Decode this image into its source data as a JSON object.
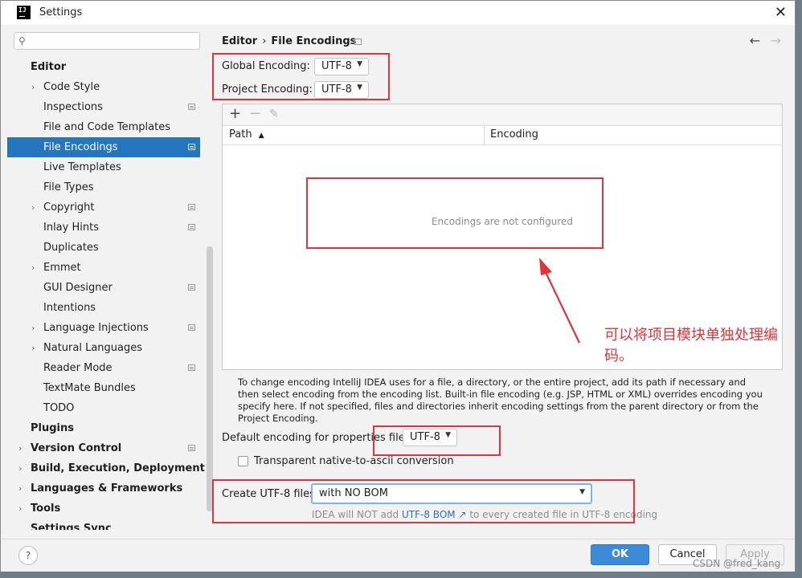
{
  "window": {
    "title": "Settings",
    "app_icon": "IJ"
  },
  "search": {
    "placeholder": ""
  },
  "sidebar": {
    "items": [
      {
        "label": "Editor"
      },
      {
        "label": "Code Style"
      },
      {
        "label": "Inspections"
      },
      {
        "label": "File and Code Templates"
      },
      {
        "label": "File Encodings"
      },
      {
        "label": "Live Templates"
      },
      {
        "label": "File Types"
      },
      {
        "label": "Copyright"
      },
      {
        "label": "Inlay Hints"
      },
      {
        "label": "Duplicates"
      },
      {
        "label": "Emmet"
      },
      {
        "label": "GUI Designer"
      },
      {
        "label": "Intentions"
      },
      {
        "label": "Language Injections"
      },
      {
        "label": "Natural Languages"
      },
      {
        "label": "Reader Mode"
      },
      {
        "label": "TextMate Bundles"
      },
      {
        "label": "TODO"
      },
      {
        "label": "Plugins"
      },
      {
        "label": "Version Control"
      },
      {
        "label": "Build, Execution, Deployment"
      },
      {
        "label": "Languages & Frameworks"
      },
      {
        "label": "Tools"
      },
      {
        "label": "Settings Sync"
      }
    ]
  },
  "breadcrumb": {
    "parent": "Editor",
    "separator": "›",
    "current": "File Encodings"
  },
  "encoding": {
    "global_label": "Global Encoding:",
    "global_value": "UTF-8",
    "project_label": "Project Encoding:",
    "project_value": "UTF-8"
  },
  "table": {
    "add": "+",
    "remove": "−",
    "edit": "✎",
    "col_path": "Path",
    "sort_indicator": "▲",
    "col_encoding": "Encoding",
    "empty_text": "Encodings are not configured"
  },
  "help_text": "To change encoding IntelliJ IDEA uses for a file, a directory, or the entire project, add its path if necessary and then select encoding from the encoding list. Built-in file encoding (e.g. JSP, HTML or XML) overrides encoding you specify here. If not specified, files and directories inherit encoding settings from the parent directory or from the Project Encoding.",
  "properties": {
    "label": "Default encoding for properties files:",
    "value": "UTF-8",
    "checkbox_label": "Transparent native-to-ascii conversion"
  },
  "utf8": {
    "label": "Create UTF-8 files:",
    "value": "with NO BOM",
    "note_prefix": "IDEA will NOT add",
    "note_link": "UTF-8 BOM ↗",
    "note_suffix": "to every created file in UTF-8 encoding"
  },
  "annotation": {
    "text": "可以将项目模块单独处理编码。",
    "color": "#e0333a"
  },
  "buttons": {
    "help": "?",
    "ok": "OK",
    "cancel": "Cancel",
    "apply": "Apply"
  },
  "watermark": "CSDN @fred_kang",
  "colors": {
    "selection": "#2675bf",
    "ok_button": "#3d8ad9",
    "annotation": "#e0333a",
    "link": "#2a6fc9"
  }
}
